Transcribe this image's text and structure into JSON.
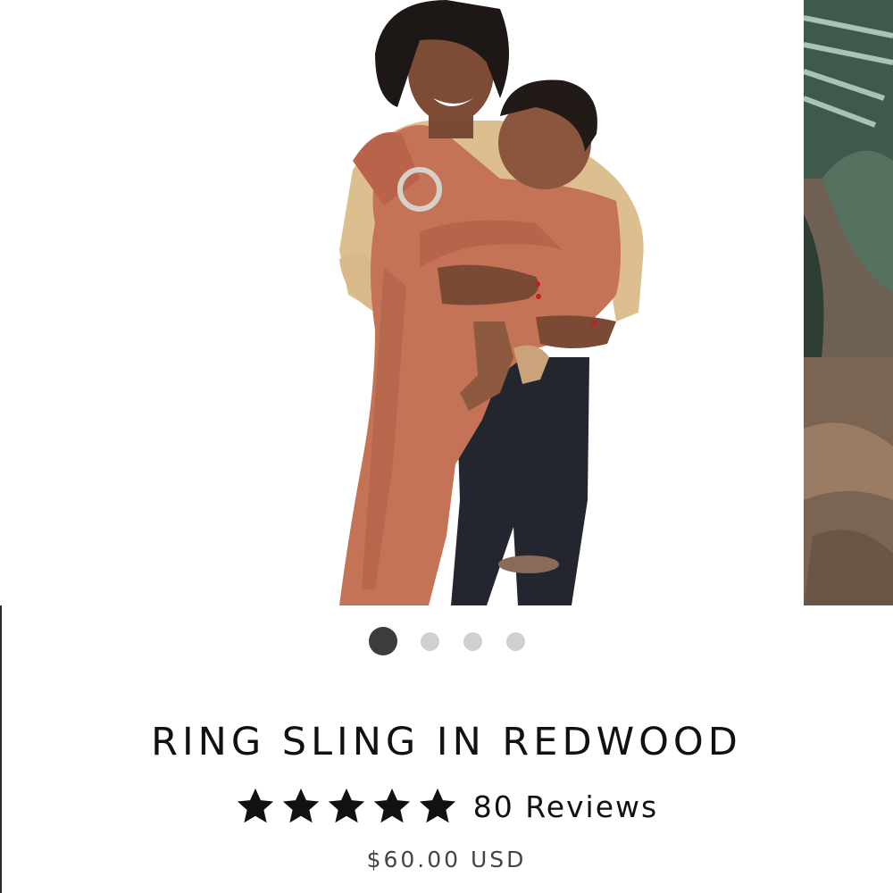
{
  "product": {
    "title": "RING SLING IN REDWOOD",
    "rating": {
      "stars": 5,
      "max_stars": 5,
      "reviews_text": "80 Reviews"
    },
    "price": "$60.00 USD"
  },
  "carousel": {
    "slide_count": 4,
    "active_index": 0,
    "colors": {
      "active_dot": "#3c3c3c",
      "inactive_dot": "#d0d0d0",
      "sling": "#c47357"
    }
  }
}
